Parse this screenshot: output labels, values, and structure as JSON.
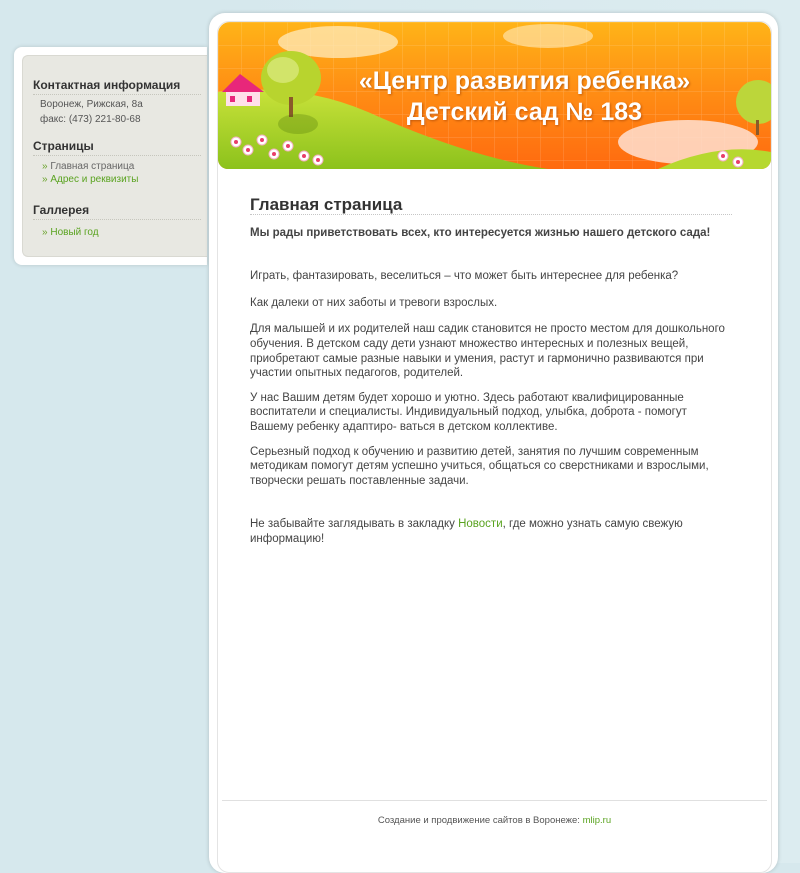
{
  "sidebar": {
    "contact": {
      "title": "Контактная информация",
      "address": "Воронеж, Рижская, 8а",
      "fax": "факс: (473) 221-80-68"
    },
    "pages": {
      "title": "Страницы",
      "items": [
        {
          "label": "Главная страница",
          "current": true
        },
        {
          "label": "Адрес и реквизиты",
          "current": false
        }
      ]
    },
    "gallery": {
      "title": "Галлерея",
      "items": [
        {
          "label": "Новый год"
        }
      ]
    },
    "bullet": "»"
  },
  "header": {
    "line1": "«Центр развития ребенка»",
    "line2": "Детский сад № 183"
  },
  "main": {
    "title": "Главная страница",
    "lead": "Мы рады приветствовать всех, кто интересуется жизнью нашего детского сада!",
    "paragraphs": [
      "Играть, фантазировать, веселиться – что может быть интереснее для ребенка?",
      "Как далеки от них заботы и тревоги взрослых.",
      "Для малышей и их родителей наш садик становится не просто местом для дошкольного обучения. В детском саду дети узнают множество интересных и полезных вещей, приобретают самые разные навыки и умения, растут и гармонично развиваются при участии опытных педагогов, родителей.",
      "У нас Вашим детям будет хорошо и уютно. Здесь работают квалифицированные воспитатели и специалисты. Индивидуальный подход, улыбка, доброта - помогут Вашему ребенку адаптиро- ваться в детском коллективе.",
      "Серьезный подход к обучению и развитию детей, занятия по лучшим современным методикам помогут детям успешно учиться, общаться со сверстниками и взрослыми, творчески решать поставленные задачи."
    ],
    "closing": {
      "before": "Не забывайте заглядывать в закладку ",
      "link": "Новости",
      "after": ", где можно узнать самую свежую информацию!"
    }
  },
  "footer": {
    "text": "Создание и продвижение сайтов в Воронеже: ",
    "link": "mlip.ru"
  },
  "colors": {
    "link": "#5aa320",
    "background": "#d6e8ed",
    "header_orange": "#ff8f14",
    "header_green": "#a9d42b"
  }
}
